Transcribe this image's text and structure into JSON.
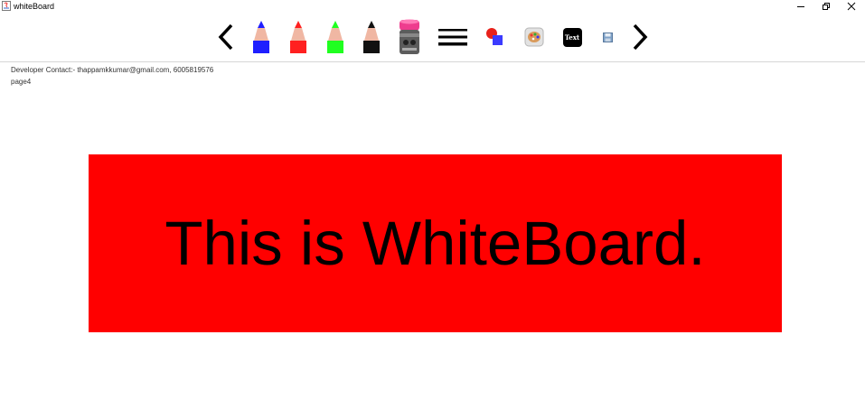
{
  "window": {
    "title": "whiteBoard",
    "controls": [
      "minimize",
      "restore",
      "close"
    ]
  },
  "toolbar": {
    "tools": [
      {
        "name": "prev-page",
        "icon": "chevron-left-icon"
      },
      {
        "name": "pencil-blue",
        "icon": "pencil-icon",
        "color": "#1f1fff"
      },
      {
        "name": "pencil-red",
        "icon": "pencil-icon",
        "color": "#ff2020"
      },
      {
        "name": "pencil-green",
        "icon": "pencil-icon",
        "color": "#20ff20"
      },
      {
        "name": "pencil-black",
        "icon": "pencil-icon",
        "color": "#111111"
      },
      {
        "name": "eraser",
        "icon": "eraser-icon"
      },
      {
        "name": "line-width",
        "icon": "lines-icon"
      },
      {
        "name": "shapes",
        "icon": "shapes-icon"
      },
      {
        "name": "color-palette",
        "icon": "palette-icon"
      },
      {
        "name": "text",
        "icon": "text-icon",
        "label": "Text"
      },
      {
        "name": "save",
        "icon": "save-icon"
      },
      {
        "name": "next-page",
        "icon": "chevron-right-icon"
      }
    ]
  },
  "info": {
    "developer_contact": "Developer Contact:- thappamkkumar@gmail.com, 6005819576",
    "page_label": "page4"
  },
  "canvas": {
    "banner_text": "This is WhiteBoard.",
    "banner_color": "#ff0000",
    "text_color": "#000000"
  }
}
